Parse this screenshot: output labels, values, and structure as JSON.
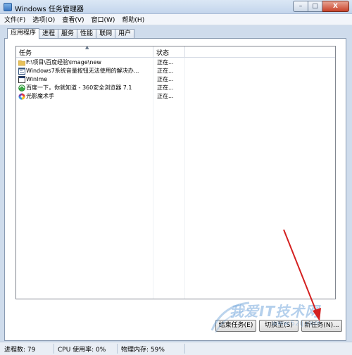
{
  "window": {
    "title": "Windows 任务管理器",
    "buttons": {
      "minimize": "–",
      "maximize": "□",
      "close": "X"
    }
  },
  "menu": [
    "文件(F)",
    "选项(O)",
    "查看(V)",
    "窗口(W)",
    "帮助(H)"
  ],
  "tabs": [
    "应用程序",
    "进程",
    "服务",
    "性能",
    "联网",
    "用户"
  ],
  "active_tab": "应用程序",
  "list": {
    "columns": [
      "任务",
      "状态"
    ],
    "rows": [
      {
        "icon": "folder-icon",
        "name": "F:\\项目\\百度经验\\image\\new",
        "status": "正在..."
      },
      {
        "icon": "document-window-icon",
        "name": "Windows7系统音量按钮无法使用的解决办...",
        "status": "正在..."
      },
      {
        "icon": "app-window-icon",
        "name": "WinIme",
        "status": "正在..."
      },
      {
        "icon": "browser-360-icon",
        "name": "百度一下，你就知道 - 360安全浏览器 7.1",
        "status": "正在..."
      },
      {
        "icon": "photo-app-icon",
        "name": "光影魔术手",
        "status": "正在..."
      }
    ]
  },
  "actions": {
    "end_task": "结束任务(E)",
    "switch_to": "切换至(S)",
    "new_task": "新任务(N)..."
  },
  "statusbar": {
    "processes": "进程数: 79",
    "cpu": "CPU 使用率: 0%",
    "memory": "物理内存: 59%"
  },
  "watermark": {
    "text": "我爱IT技术网",
    "url": "www.52ij.com"
  },
  "colors": {
    "annotation_arrow": "#d42020",
    "selection_accent": "#3a77c2"
  }
}
